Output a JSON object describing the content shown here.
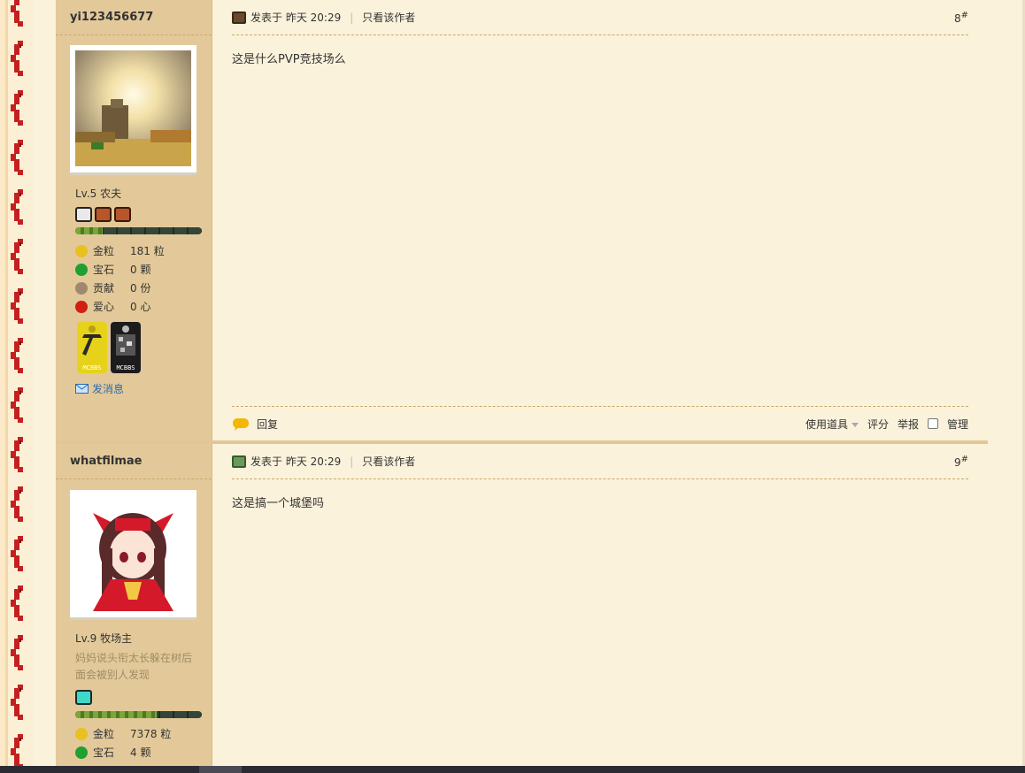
{
  "posts": [
    {
      "author": "yi123456677",
      "level": "Lv.5 农夫",
      "signature": "",
      "progress": 0.22,
      "stats": [
        {
          "icon": "gold-nugget-icon",
          "label": "金粒",
          "value": "181 粒",
          "color": "#e8c020"
        },
        {
          "icon": "emerald-icon",
          "label": "宝石",
          "value": "0 颗",
          "color": "#20a030"
        },
        {
          "icon": "contribution-icon",
          "label": "贡献",
          "value": "0 份",
          "color": "#a08870"
        },
        {
          "icon": "apple-heart-icon",
          "label": "爱心",
          "value": "0 心",
          "color": "#d02010"
        }
      ],
      "send_message": "发消息",
      "posted_label": "发表于",
      "posted_time": "昨天 20:29",
      "only_author": "只看该作者",
      "floor": "8",
      "floor_mark": "#",
      "content": "这是什么PVP竞技场么",
      "reply": "回复",
      "use_item": "使用道具",
      "rate": "评分",
      "report": "举报",
      "manage": "管理"
    },
    {
      "author": "whatfilmae",
      "level": "Lv.9 牧场主",
      "signature": "妈妈说头衔太长躲在树后面会被别人发现",
      "progress": 0.64,
      "stats": [
        {
          "icon": "gold-nugget-icon",
          "label": "金粒",
          "value": "7378 粒",
          "color": "#e8c020"
        },
        {
          "icon": "emerald-icon",
          "label": "宝石",
          "value": "4 颗",
          "color": "#20a030"
        }
      ],
      "posted_label": "发表于",
      "posted_time": "昨天 20:29",
      "only_author": "只看该作者",
      "floor": "9",
      "floor_mark": "#",
      "content": "这是搞一个城堡吗"
    }
  ],
  "badges": [
    {
      "name": "pickaxe-badge",
      "text": "MCBBS",
      "color": "#e6d21a"
    },
    {
      "name": "ore-badge",
      "text": "MCBBS",
      "color": "#1c1c1c"
    }
  ]
}
